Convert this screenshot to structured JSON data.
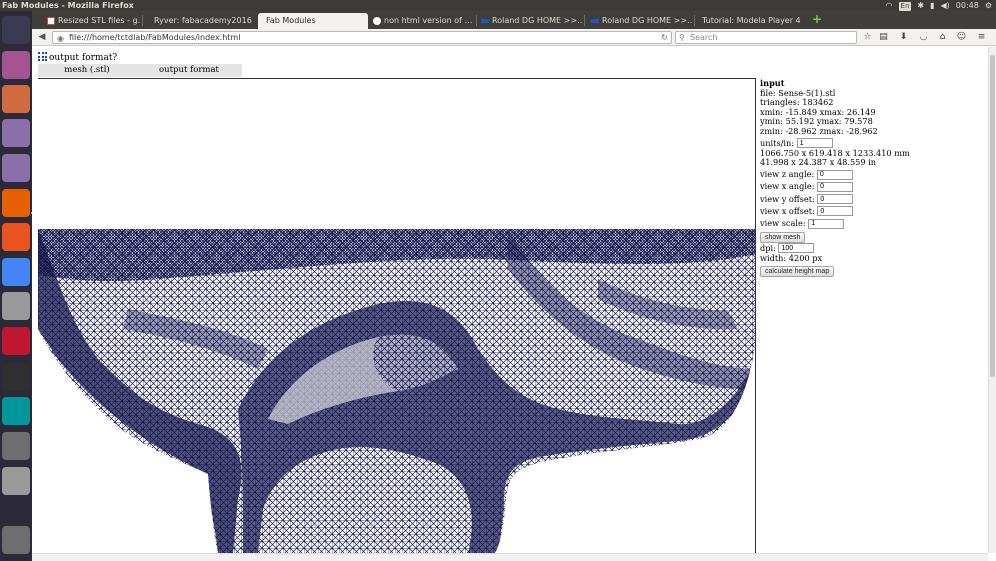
{
  "system": {
    "window_title": "Fab Modules - Mozilla Firefox",
    "keyboard_layout": "En",
    "clock": "00:48"
  },
  "launcher": {
    "items": [
      {
        "name": "ubuntu-dash-icon",
        "color": "#3a3a52"
      },
      {
        "name": "workspace-icon",
        "color": "#a4548f"
      },
      {
        "name": "files-icon",
        "color": "#d16a3e"
      },
      {
        "name": "inkscape-icon",
        "color": "#8b6fa8"
      },
      {
        "name": "inkscape-icon-2",
        "color": "#8b6fa8"
      },
      {
        "name": "firefox-icon",
        "color": "#e66000"
      },
      {
        "name": "software-center-icon",
        "color": "#e9531d"
      },
      {
        "name": "chrome-icon",
        "color": "#4285f4"
      },
      {
        "name": "system-settings-icon",
        "color": "#9a9a9a"
      },
      {
        "name": "app-icon",
        "color": "#c0172f"
      },
      {
        "name": "terminal-icon",
        "color": "#2f2f2f"
      },
      {
        "name": "arduino-icon",
        "color": "#00979c"
      },
      {
        "name": "disk-icon",
        "color": "#6e6e6e"
      },
      {
        "name": "usb-drive-icon",
        "color": "#9a9a9a"
      },
      {
        "name": "trash-icon",
        "color": "#6e6e6e"
      }
    ]
  },
  "browser": {
    "tabs": [
      {
        "label": "Resized STL files - g…",
        "favicon_color": "#d44638"
      },
      {
        "label": "Ryver: fabacademy2016",
        "favicon_color": ""
      },
      {
        "label": "Fab Modules",
        "favicon_color": "",
        "active": true
      },
      {
        "label": "non html version of …",
        "favicon_color": "#ffffff"
      },
      {
        "label": "Roland DG HOME >>…",
        "favicon_color": "#1a56c8"
      },
      {
        "label": "Roland DG HOME >>…",
        "favicon_color": "#1a56c8"
      },
      {
        "label": "Tutorial: Modela Player 4",
        "favicon_color": ""
      }
    ],
    "url": "file:///home/tctdlab/FabModules/index.html",
    "search_placeholder": "Search"
  },
  "page": {
    "menu_label": "output format?",
    "module_tabs": [
      "mesh (.stl)",
      "output format"
    ],
    "panel": {
      "heading": "input",
      "file": "file: Sense-5(1).stl",
      "triangles": "triangles: 183462",
      "xrange": "xmin: -15.849 xmax: 26.149",
      "yrange": "ymin: 55.192 ymax: 79.578",
      "zrange": "zmin: -28.962 zmax: -28.962",
      "units_label": "units/in:",
      "units_value": "1",
      "size_mm": "1066.750 x 619.418 x 1233.410 mm",
      "size_in": "41.998 x 24.387 x 48.559 in",
      "view_z_label": "view z angle:",
      "view_z_value": "0",
      "view_x_label": "view x angle:",
      "view_x_value": "0",
      "view_y_offset_label": "view y offset:",
      "view_y_offset_value": "0",
      "view_x_offset_label": "view x offset:",
      "view_x_offset_value": "0",
      "view_scale_label": "view scale:",
      "view_scale_value": "1",
      "show_mesh_button": "show mesh",
      "dpi_label": "dpi:",
      "dpi_value": "100",
      "width_text": "width: 4200 px",
      "calc_button": "calculate height map"
    },
    "mesh_color": "#15154e"
  }
}
